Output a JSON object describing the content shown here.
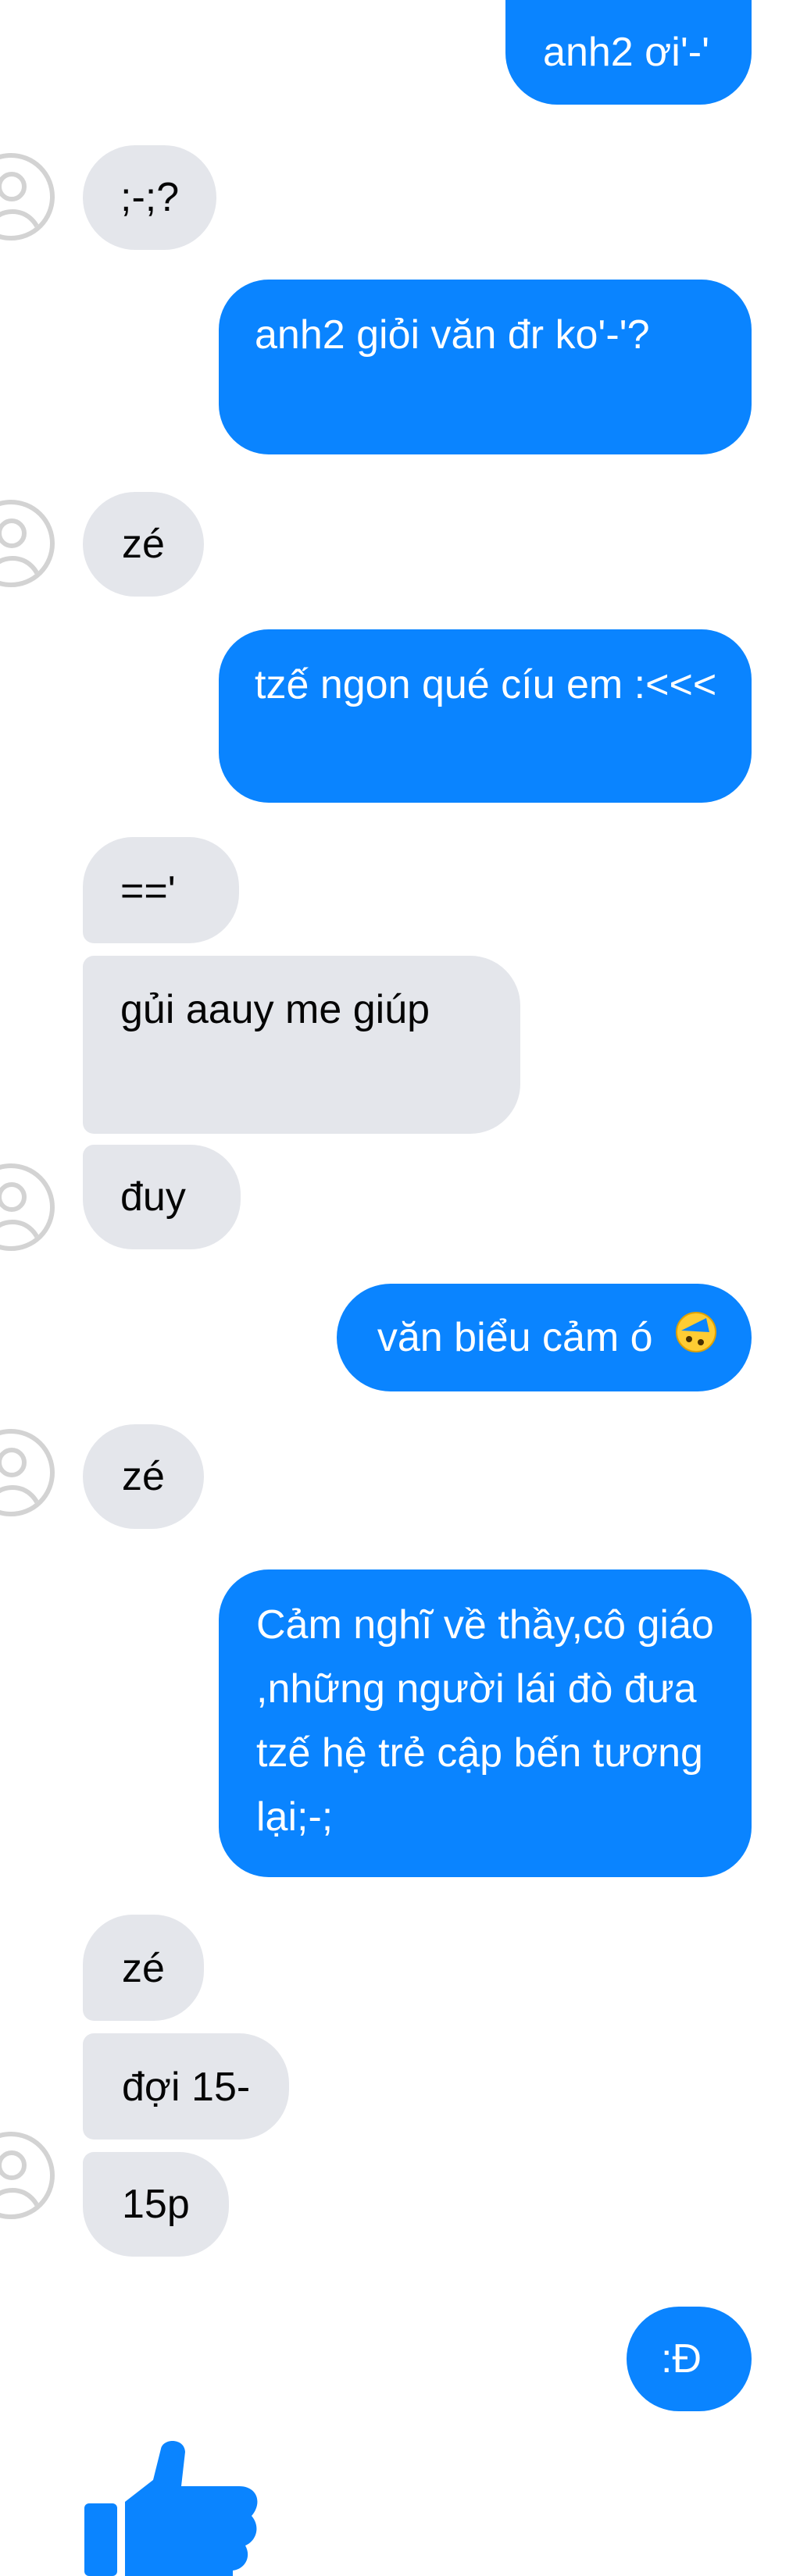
{
  "messages": [
    {
      "direction": "outgoing",
      "text": "anh2 ơi'-'"
    },
    {
      "direction": "incoming",
      "text": ";-;?"
    },
    {
      "direction": "outgoing",
      "text": "anh2 giỏi văn đr ko'-'?"
    },
    {
      "direction": "incoming",
      "text": "zé"
    },
    {
      "direction": "outgoing",
      "text": "tzế ngon qué cíu em :<<<"
    },
    {
      "direction": "incoming",
      "text": "=='"
    },
    {
      "direction": "incoming",
      "text": "gủi aauy me giúp"
    },
    {
      "direction": "incoming",
      "text": "đuy"
    },
    {
      "direction": "outgoing",
      "text": "văn biểu cảm ó",
      "emoji": "laughing-face-emoji"
    },
    {
      "direction": "incoming",
      "text": "zé"
    },
    {
      "direction": "outgoing",
      "text": "Cảm nghĩ về thầy,cô giáo ,những người lái đò đưa tzế hệ trẻ cập bến tương lại;-;"
    },
    {
      "direction": "incoming",
      "text": "zé"
    },
    {
      "direction": "incoming",
      "text": "đợi 15-"
    },
    {
      "direction": "incoming",
      "text": "15p"
    },
    {
      "direction": "outgoing",
      "text": ":Đ"
    }
  ],
  "like_icon": "thumbs-up-icon",
  "colors": {
    "outgoing": "#0a84ff",
    "incoming": "#e4e6eb",
    "like": "#0a84ff"
  }
}
